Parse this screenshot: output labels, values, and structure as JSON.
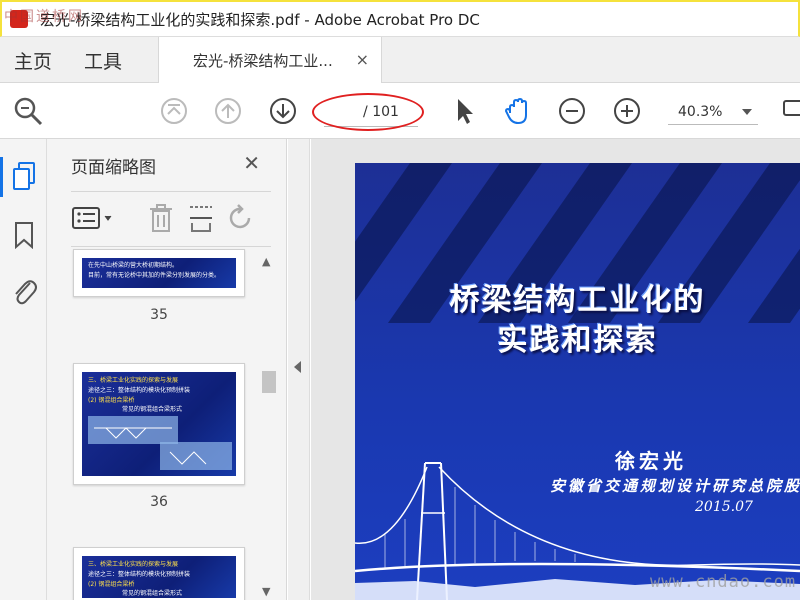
{
  "window": {
    "title": "宏光-桥梁结构工业化的实践和探索.pdf - Adobe Acrobat Pro DC",
    "watermark_top_left": "中国道桥网"
  },
  "tabs": {
    "home": "主页",
    "tools": "工具",
    "document": "宏光-桥梁结构工业...",
    "close": "×"
  },
  "toolbar": {
    "page_current": "",
    "page_total": "/ 101",
    "zoom": "40.3%"
  },
  "panel": {
    "title": "页面缩略图",
    "close": "✕",
    "thumbnails": [
      {
        "label": "35",
        "lines": [
          "在先中山桥梁的营大桥初期结构。",
          "目前，常有无论桥中其加的件梁分别发展的分类。"
        ]
      },
      {
        "label": "36",
        "lines": [
          "三、桥梁工业化实践的探索与发展",
          "途径之三：整体结构的模块化预制拼装",
          "(2) 钢混组合梁桥",
          "常见的钢混组合梁形式"
        ]
      },
      {
        "label": "",
        "lines": [
          "三、桥梁工业化实践的探索与发展",
          "途径之三：整体结构的模块化预制拼装",
          "(2) 钢混组合梁桥",
          "常见的钢混组合梁形式"
        ]
      }
    ]
  },
  "slide": {
    "title_line1": "桥梁结构工业化的",
    "title_line2": "实践和探索",
    "author": "徐宏光",
    "org": "安徽省交通规划设计研究总院股",
    "date": "2015.07"
  },
  "watermark_bottom_right": "www.cndao.com",
  "colors": {
    "accent": "#1473e6",
    "annotation_red": "#e02020",
    "slide_blue": "#1a38b0"
  }
}
